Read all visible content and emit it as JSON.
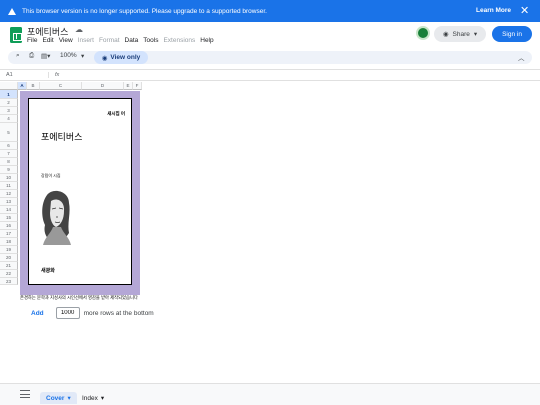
{
  "banner": {
    "message": "This browser version is no longer supported. Please upgrade to a supported browser.",
    "learn_more": "Learn More",
    "close": "✕"
  },
  "app": {
    "title": "포에티버스",
    "menus": [
      "File",
      "Edit",
      "View",
      "Insert",
      "Format",
      "Data",
      "Tools",
      "Extensions",
      "Help"
    ],
    "disabled_menus": [
      "Insert",
      "Format",
      "Extensions"
    ]
  },
  "actions": {
    "share": "Share",
    "signin": "Sign in"
  },
  "toolbar": {
    "zoom": "100%",
    "view_only": "View only"
  },
  "formula": {
    "cell_ref": "A1",
    "fx": "fx"
  },
  "columns": [
    "A",
    "B",
    "C",
    "D",
    "E",
    "F"
  ],
  "rows": [
    "1",
    "2",
    "3",
    "4",
    "5",
    "6",
    "7",
    "8",
    "9",
    "10",
    "11",
    "12",
    "13",
    "14",
    "15",
    "16",
    "17",
    "18",
    "19",
    "20",
    "21",
    "22",
    "23"
  ],
  "cover": {
    "series": "새시집 어",
    "title": "포에티버스",
    "author": "강림이 시집",
    "publisher": "새광화"
  },
  "row23_text": "존경하는 문학과 지성사의 시인선에서 영감을 받아 제작되었습니다",
  "add_rows": {
    "add": "Add",
    "count": "1000",
    "suffix": "more rows at the bottom"
  },
  "sheets": [
    {
      "name": "Cover",
      "active": true
    },
    {
      "name": "Index",
      "active": false
    }
  ],
  "colors": {
    "accent": "#1a73e8",
    "cover_bg": "#b4a7d6",
    "brand": "#0f9d58"
  }
}
